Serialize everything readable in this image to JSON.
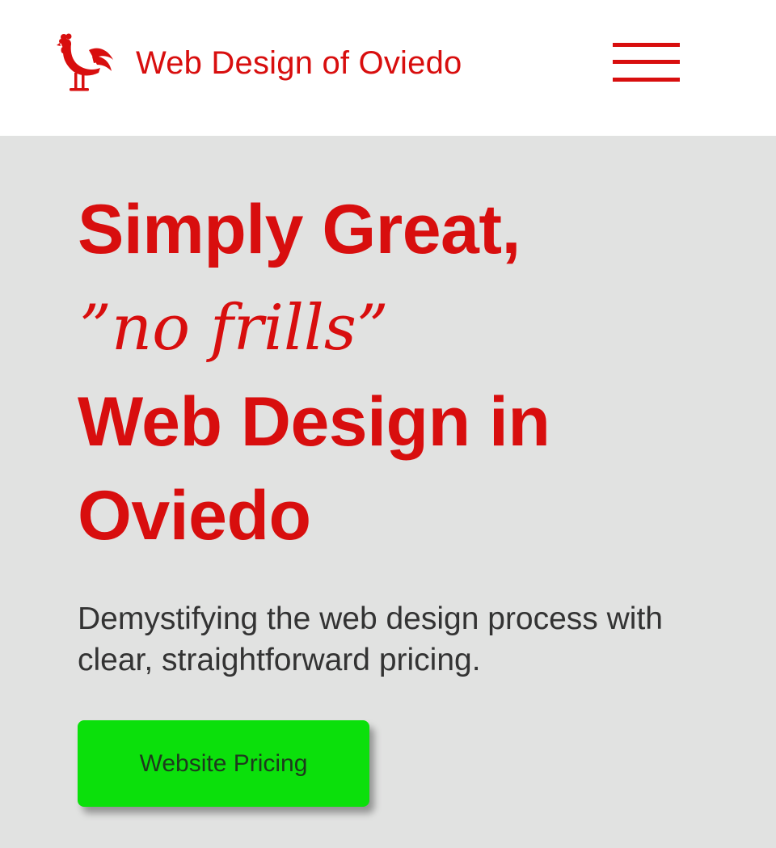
{
  "header": {
    "site_title": "Web Design of Oviedo",
    "logo_icon": "rooster-icon",
    "menu_icon": "hamburger-menu-icon"
  },
  "hero": {
    "headline_line1": "Simply Great,",
    "tagline": "”no frills”",
    "headline_line3": "Web Design in Oviedo",
    "subtext": "Demystifying the web design process with clear, straightforward pricing.",
    "cta_label": "Website Pricing"
  },
  "colors": {
    "brand_red": "#d80e0e",
    "background_gray": "#e1e2e1",
    "header_white": "#ffffff",
    "cta_green": "#0be00b",
    "body_text": "#333333"
  }
}
